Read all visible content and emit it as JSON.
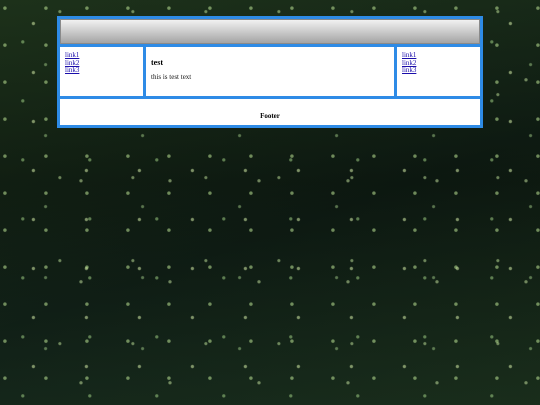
{
  "theme": {
    "frame_color": "#2e8be6",
    "panel_color": "#ffffff",
    "link_color": "#1a0dab"
  },
  "left_nav": {
    "links": [
      {
        "label": "link1"
      },
      {
        "label": "link2"
      },
      {
        "label": "link3"
      }
    ]
  },
  "main": {
    "title": "test",
    "body": "this is test text"
  },
  "right_nav": {
    "links": [
      {
        "label": "link1"
      },
      {
        "label": "link2"
      },
      {
        "label": "link3"
      }
    ]
  },
  "footer": {
    "text": "Footer"
  }
}
